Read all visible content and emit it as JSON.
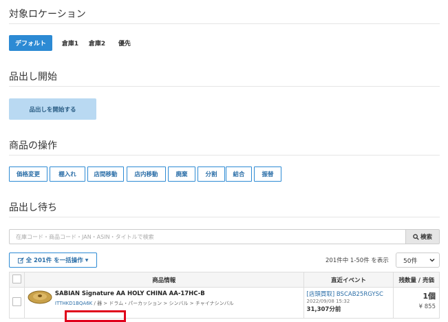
{
  "sections": {
    "location": "対象ロケーション",
    "picking_start": "品出し開始",
    "operations": "商品の操作",
    "waiting": "品出し待ち"
  },
  "location_tabs": [
    {
      "label": "デフォルト",
      "active": true
    },
    {
      "label": "倉庫1",
      "active": false
    },
    {
      "label": "倉庫2",
      "active": false
    },
    {
      "label": "優先",
      "active": false
    }
  ],
  "start_button": "品出しを開始する",
  "operation_buttons": [
    "価格変更",
    "棚入れ",
    "店間移動",
    "店内移動",
    "廃棄",
    "分割",
    "結合",
    "振替"
  ],
  "search": {
    "placeholder": "在庫コード・商品コード・JAN・ASIN・タイトルで検索",
    "button": "検索"
  },
  "bulk_button": "全 201件 を一括操作",
  "count_text": "201件中 1-50件 を表示",
  "per_page": "50件",
  "table": {
    "headers": [
      "商品情報",
      "直近イベント",
      "残数量 / 売価"
    ],
    "rows": [
      {
        "title": "SABIAN Signature AA HOLY CHINA AA-17HC-B",
        "code": "ITTHKD1BQA6K",
        "category": "楽器 > ドラム・パーカッション > シンバル > チャイナシンバル",
        "category_visible": "器 > ドラム・パーカッション > シンバル > チャイナシンバル",
        "event": "[店頭買取] BSCAB25RGYSC",
        "event_date": "2022/09/08 15:32",
        "elapsed": "31,307分前",
        "qty": "1個",
        "price": "¥ 855"
      }
    ]
  },
  "colors": {
    "accent": "#2c8ad4",
    "highlight": "#e0001b"
  }
}
